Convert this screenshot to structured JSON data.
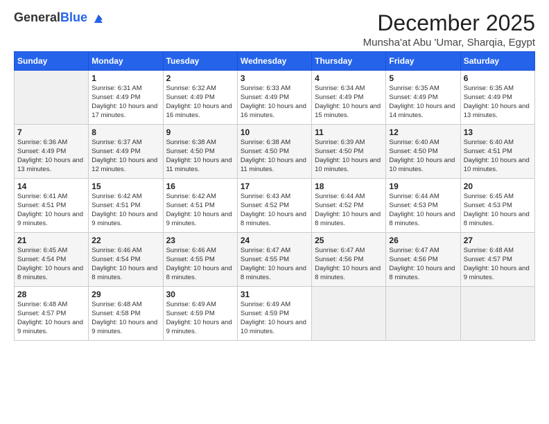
{
  "header": {
    "logo_general": "General",
    "logo_blue": "Blue",
    "title": "December 2025",
    "subtitle": "Munsha'at Abu 'Umar, Sharqia, Egypt"
  },
  "days_of_week": [
    "Sunday",
    "Monday",
    "Tuesday",
    "Wednesday",
    "Thursday",
    "Friday",
    "Saturday"
  ],
  "weeks": [
    [
      {
        "day": "",
        "empty": true
      },
      {
        "day": "1",
        "sunrise": "Sunrise: 6:31 AM",
        "sunset": "Sunset: 4:49 PM",
        "daylight": "Daylight: 10 hours and 17 minutes."
      },
      {
        "day": "2",
        "sunrise": "Sunrise: 6:32 AM",
        "sunset": "Sunset: 4:49 PM",
        "daylight": "Daylight: 10 hours and 16 minutes."
      },
      {
        "day": "3",
        "sunrise": "Sunrise: 6:33 AM",
        "sunset": "Sunset: 4:49 PM",
        "daylight": "Daylight: 10 hours and 16 minutes."
      },
      {
        "day": "4",
        "sunrise": "Sunrise: 6:34 AM",
        "sunset": "Sunset: 4:49 PM",
        "daylight": "Daylight: 10 hours and 15 minutes."
      },
      {
        "day": "5",
        "sunrise": "Sunrise: 6:35 AM",
        "sunset": "Sunset: 4:49 PM",
        "daylight": "Daylight: 10 hours and 14 minutes."
      },
      {
        "day": "6",
        "sunrise": "Sunrise: 6:35 AM",
        "sunset": "Sunset: 4:49 PM",
        "daylight": "Daylight: 10 hours and 13 minutes."
      }
    ],
    [
      {
        "day": "7",
        "sunrise": "Sunrise: 6:36 AM",
        "sunset": "Sunset: 4:49 PM",
        "daylight": "Daylight: 10 hours and 13 minutes."
      },
      {
        "day": "8",
        "sunrise": "Sunrise: 6:37 AM",
        "sunset": "Sunset: 4:49 PM",
        "daylight": "Daylight: 10 hours and 12 minutes."
      },
      {
        "day": "9",
        "sunrise": "Sunrise: 6:38 AM",
        "sunset": "Sunset: 4:50 PM",
        "daylight": "Daylight: 10 hours and 11 minutes."
      },
      {
        "day": "10",
        "sunrise": "Sunrise: 6:38 AM",
        "sunset": "Sunset: 4:50 PM",
        "daylight": "Daylight: 10 hours and 11 minutes."
      },
      {
        "day": "11",
        "sunrise": "Sunrise: 6:39 AM",
        "sunset": "Sunset: 4:50 PM",
        "daylight": "Daylight: 10 hours and 10 minutes."
      },
      {
        "day": "12",
        "sunrise": "Sunrise: 6:40 AM",
        "sunset": "Sunset: 4:50 PM",
        "daylight": "Daylight: 10 hours and 10 minutes."
      },
      {
        "day": "13",
        "sunrise": "Sunrise: 6:40 AM",
        "sunset": "Sunset: 4:51 PM",
        "daylight": "Daylight: 10 hours and 10 minutes."
      }
    ],
    [
      {
        "day": "14",
        "sunrise": "Sunrise: 6:41 AM",
        "sunset": "Sunset: 4:51 PM",
        "daylight": "Daylight: 10 hours and 9 minutes."
      },
      {
        "day": "15",
        "sunrise": "Sunrise: 6:42 AM",
        "sunset": "Sunset: 4:51 PM",
        "daylight": "Daylight: 10 hours and 9 minutes."
      },
      {
        "day": "16",
        "sunrise": "Sunrise: 6:42 AM",
        "sunset": "Sunset: 4:51 PM",
        "daylight": "Daylight: 10 hours and 9 minutes."
      },
      {
        "day": "17",
        "sunrise": "Sunrise: 6:43 AM",
        "sunset": "Sunset: 4:52 PM",
        "daylight": "Daylight: 10 hours and 8 minutes."
      },
      {
        "day": "18",
        "sunrise": "Sunrise: 6:44 AM",
        "sunset": "Sunset: 4:52 PM",
        "daylight": "Daylight: 10 hours and 8 minutes."
      },
      {
        "day": "19",
        "sunrise": "Sunrise: 6:44 AM",
        "sunset": "Sunset: 4:53 PM",
        "daylight": "Daylight: 10 hours and 8 minutes."
      },
      {
        "day": "20",
        "sunrise": "Sunrise: 6:45 AM",
        "sunset": "Sunset: 4:53 PM",
        "daylight": "Daylight: 10 hours and 8 minutes."
      }
    ],
    [
      {
        "day": "21",
        "sunrise": "Sunrise: 6:45 AM",
        "sunset": "Sunset: 4:54 PM",
        "daylight": "Daylight: 10 hours and 8 minutes."
      },
      {
        "day": "22",
        "sunrise": "Sunrise: 6:46 AM",
        "sunset": "Sunset: 4:54 PM",
        "daylight": "Daylight: 10 hours and 8 minutes."
      },
      {
        "day": "23",
        "sunrise": "Sunrise: 6:46 AM",
        "sunset": "Sunset: 4:55 PM",
        "daylight": "Daylight: 10 hours and 8 minutes."
      },
      {
        "day": "24",
        "sunrise": "Sunrise: 6:47 AM",
        "sunset": "Sunset: 4:55 PM",
        "daylight": "Daylight: 10 hours and 8 minutes."
      },
      {
        "day": "25",
        "sunrise": "Sunrise: 6:47 AM",
        "sunset": "Sunset: 4:56 PM",
        "daylight": "Daylight: 10 hours and 8 minutes."
      },
      {
        "day": "26",
        "sunrise": "Sunrise: 6:47 AM",
        "sunset": "Sunset: 4:56 PM",
        "daylight": "Daylight: 10 hours and 8 minutes."
      },
      {
        "day": "27",
        "sunrise": "Sunrise: 6:48 AM",
        "sunset": "Sunset: 4:57 PM",
        "daylight": "Daylight: 10 hours and 9 minutes."
      }
    ],
    [
      {
        "day": "28",
        "sunrise": "Sunrise: 6:48 AM",
        "sunset": "Sunset: 4:57 PM",
        "daylight": "Daylight: 10 hours and 9 minutes."
      },
      {
        "day": "29",
        "sunrise": "Sunrise: 6:48 AM",
        "sunset": "Sunset: 4:58 PM",
        "daylight": "Daylight: 10 hours and 9 minutes."
      },
      {
        "day": "30",
        "sunrise": "Sunrise: 6:49 AM",
        "sunset": "Sunset: 4:59 PM",
        "daylight": "Daylight: 10 hours and 9 minutes."
      },
      {
        "day": "31",
        "sunrise": "Sunrise: 6:49 AM",
        "sunset": "Sunset: 4:59 PM",
        "daylight": "Daylight: 10 hours and 10 minutes."
      },
      {
        "day": "",
        "empty": true
      },
      {
        "day": "",
        "empty": true
      },
      {
        "day": "",
        "empty": true
      }
    ]
  ]
}
